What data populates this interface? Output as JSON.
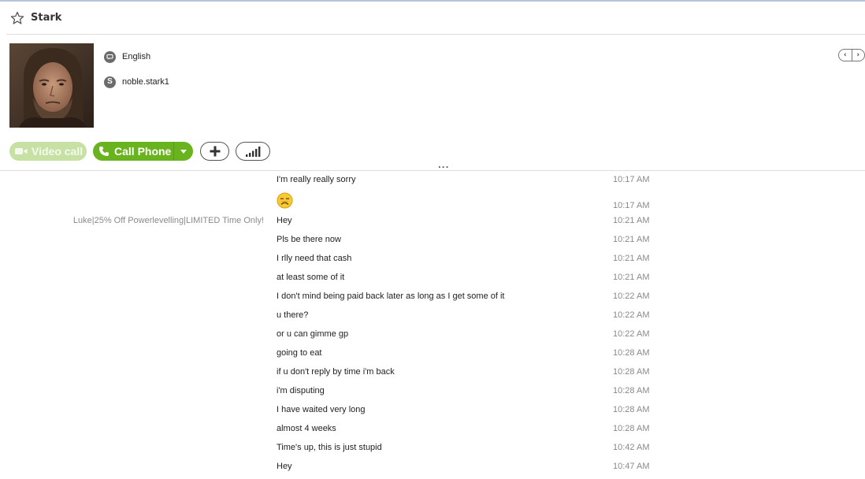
{
  "header": {
    "contact_name": "Stark"
  },
  "profile": {
    "language": "English",
    "username": "noble.stark1"
  },
  "buttons": {
    "video_call": "Video call",
    "call_phone": "Call Phone"
  },
  "toolbar": {
    "expander": "..."
  },
  "messages": [
    {
      "sender": "",
      "text": "I'm really really sorry",
      "time": "10:17 AM"
    },
    {
      "sender": "",
      "text": "",
      "time": "10:17 AM",
      "emoji": "sad-face-emoji"
    },
    {
      "sender": "Luke|25% Off Powerlevelling|LIMITED Time Only!",
      "text": "Hey",
      "time": "10:21 AM"
    },
    {
      "sender": "",
      "text": "Pls be there now",
      "time": "10:21 AM"
    },
    {
      "sender": "",
      "text": "I rlly need that cash",
      "time": "10:21 AM"
    },
    {
      "sender": "",
      "text": "at least some of it",
      "time": "10:21 AM"
    },
    {
      "sender": "",
      "text": "I don't mind being paid back later as long as I get some of it",
      "time": "10:22 AM"
    },
    {
      "sender": "",
      "text": "u there?",
      "time": "10:22 AM"
    },
    {
      "sender": "",
      "text": "or u can gimme gp",
      "time": "10:22 AM"
    },
    {
      "sender": "",
      "text": "going to eat",
      "time": "10:28 AM"
    },
    {
      "sender": "",
      "text": "if u don't reply by time i'm back",
      "time": "10:28 AM"
    },
    {
      "sender": "",
      "text": "i'm disputing",
      "time": "10:28 AM"
    },
    {
      "sender": "",
      "text": "I have waited very long",
      "time": "10:28 AM"
    },
    {
      "sender": "",
      "text": "almost 4 weeks",
      "time": "10:28 AM"
    },
    {
      "sender": "",
      "text": "Time's up, this is just stupid",
      "time": "10:42 AM"
    },
    {
      "sender": "",
      "text": "Hey",
      "time": "10:47 AM"
    }
  ],
  "colors": {
    "call_green": "#69b31e",
    "video_green_disabled": "#c6e1a3",
    "timestamp_gray": "#8a8a8a"
  }
}
